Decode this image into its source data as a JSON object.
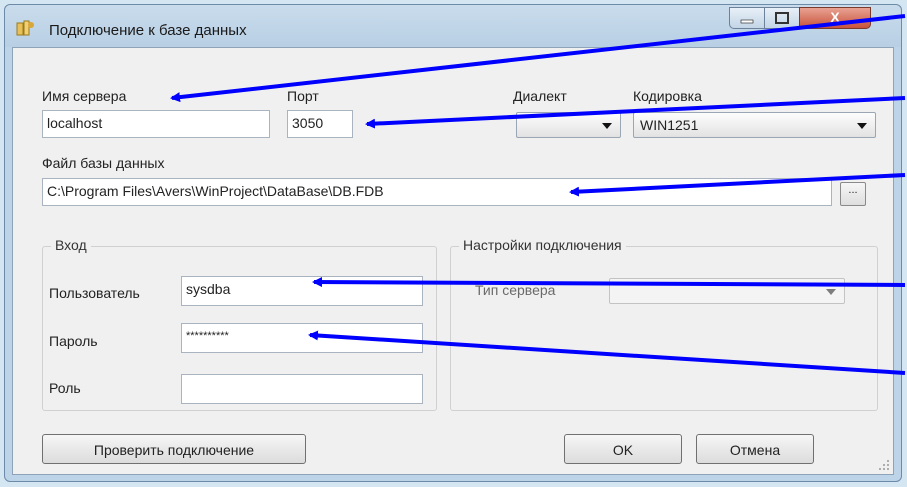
{
  "window": {
    "title": "Подключение к базе данных"
  },
  "titlebar_controls": {
    "minimize_icon": "minimize-icon",
    "maximize_icon": "maximize-icon",
    "close_label": "X"
  },
  "server": {
    "label": "Имя сервера",
    "value": "localhost"
  },
  "port": {
    "label": "Порт",
    "value": "3050"
  },
  "dialect": {
    "label": "Диалект",
    "value": ""
  },
  "encoding": {
    "label": "Кодировка",
    "value": "WIN1251"
  },
  "dbfile": {
    "label": "Файл базы данных",
    "value": "C:\\Program Files\\Avers\\WinProject\\DataBase\\DB.FDB",
    "browse_label": "..."
  },
  "login": {
    "title": "Вход",
    "user_label": "Пользователь",
    "user_value": "sysdba",
    "password_label": "Пароль",
    "password_value": "**********",
    "role_label": "Роль",
    "role_value": ""
  },
  "conn_settings": {
    "title": "Настройки подключения",
    "server_type_label": "Тип сервера",
    "server_type_value": ""
  },
  "buttons": {
    "test": "Проверить подключение",
    "ok": "OK",
    "cancel": "Отмена"
  },
  "colors": {
    "annotation_arrow": "#0000ff",
    "close_button": "#c8523b",
    "desktop": "#d4e6f2"
  }
}
